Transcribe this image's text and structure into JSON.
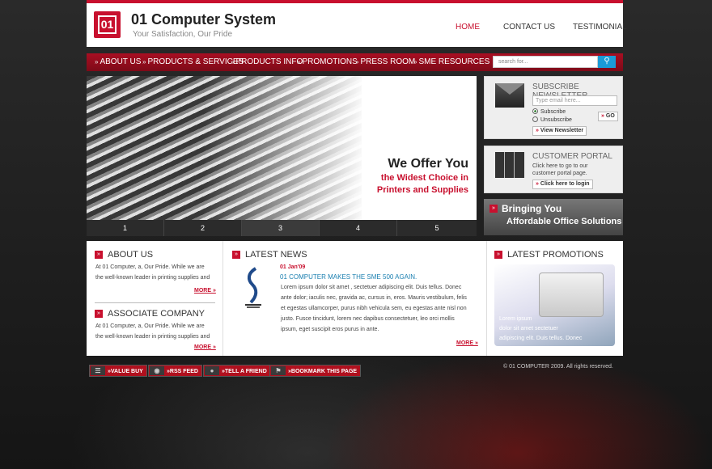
{
  "brand": {
    "logo_text": "01",
    "title": "01 Computer System",
    "tagline": "Your Satisfaction, Our Pride"
  },
  "topnav": [
    {
      "label": "HOME"
    },
    {
      "label": "CONTACT US"
    },
    {
      "label": "TESTIMONIAL"
    }
  ],
  "mainnav": [
    {
      "label": "ABOUT US"
    },
    {
      "label": "PRODUCTS & SERVICES"
    },
    {
      "label": "PRODUCTS INFO"
    },
    {
      "label": "PROMOTIONS"
    },
    {
      "label": "PRESS ROOM"
    },
    {
      "label": "SME RESOURCES"
    }
  ],
  "search": {
    "placeholder": "search for..."
  },
  "hero": {
    "line1": "We Offer You",
    "line2": "the Widest Choice in",
    "line3": "Printers and Supplies",
    "slides": [
      "1",
      "2",
      "3",
      "4",
      "5"
    ],
    "active_slide": 3
  },
  "newsletter": {
    "title": "SUBSCRIBE NEWSLETTER",
    "email_placeholder": "Type email here...",
    "subscribe": "Subscribe",
    "unsubscribe": "Unsubscribe",
    "go": "GO",
    "view": "View Newsletter"
  },
  "portal": {
    "title": "CUSTOMER PORTAL",
    "text1": "Click here to go to our",
    "text2": "customer portal page.",
    "login": "Click here to login"
  },
  "bringing": {
    "line1": "Bringing You",
    "line2": "Affordable Office Solutions"
  },
  "about": {
    "title": "ABOUT US",
    "line1": "At 01 Computer, a, Our Pride. While we are",
    "line2": "the well-known leader in printing supplies and",
    "more": "MORE »"
  },
  "associate": {
    "title": "ASSOCIATE COMPANY",
    "line1": "At 01 Computer, a, Our Pride. While we are",
    "line2": "the well-known leader in printing supplies and",
    "more": "MORE »"
  },
  "news": {
    "title": "LATEST NEWS",
    "date": "01 Jan'09",
    "headline": "01 COMPUTER MAKES THE SME 500 AGAIN.",
    "lines": [
      "Lorem ipsum dolor sit amet    , sectetuer adipiscing elit. Duis tellus. Donec",
      "ante dolor; iaculis nec, gravida ac, cursus in, eros. Mauris vestibulum, felis",
      "et egestas ullamcorper, purus nibh vehicula sem, eu egestas ante nisl non",
      "justo. Fusce tincidunt, lorem nec dapibus consectetuer, leo orci mollis",
      "ipsum, eget suscipit eros purus in ante."
    ],
    "more": "MORE »"
  },
  "promotions": {
    "title": "LATEST PROMOTIONS",
    "line1": "Lorem    ipsum",
    "line2": "dolor  sit  amet         sectetuer",
    "line3": "adipiscing elit. Duis tellus. Donec"
  },
  "footer": {
    "buttons": [
      "VALUE BUY",
      "RSS FEED",
      "TELL A FRIEND",
      "BOOKMARK THIS PAGE"
    ],
    "copyright": "© 01 COMPUTER 2009. All rights reserved."
  },
  "colors": {
    "accent": "#c8102e",
    "link": "#1a7fb0"
  }
}
